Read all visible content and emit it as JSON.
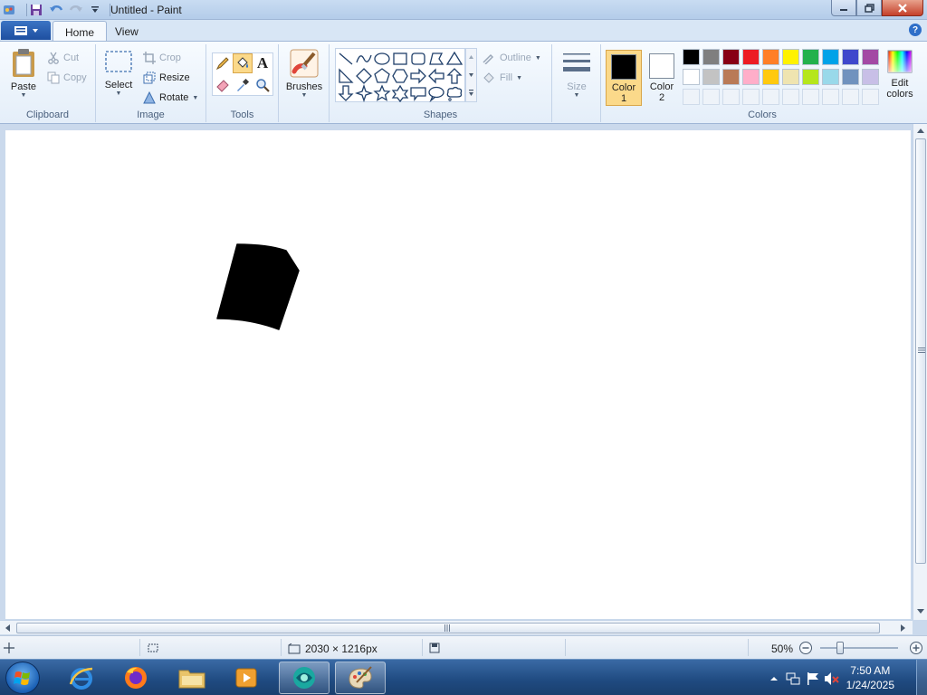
{
  "window": {
    "title": "Untitled - Paint"
  },
  "tabs": [
    {
      "label": "Home"
    },
    {
      "label": "View"
    }
  ],
  "clipboard": {
    "group_label": "Clipboard",
    "paste_label": "Paste",
    "cut_label": "Cut",
    "copy_label": "Copy"
  },
  "image": {
    "group_label": "Image",
    "select_label": "Select",
    "crop_label": "Crop",
    "resize_label": "Resize",
    "rotate_label": "Rotate"
  },
  "tools": {
    "group_label": "Tools",
    "text_tool_glyph": "A"
  },
  "brushes": {
    "label": "Brushes"
  },
  "shapes": {
    "group_label": "Shapes",
    "outline_label": "Outline",
    "fill_label": "Fill"
  },
  "size": {
    "label": "Size"
  },
  "colors": {
    "group_label": "Colors",
    "color1_label": "Color",
    "color1_num": "1",
    "color2_label": "Color",
    "color2_num": "2",
    "edit_label": "Edit",
    "edit_label2": "colors",
    "color1": "#000000",
    "color2": "#ffffff",
    "palette_row1": [
      "#000000",
      "#7f7f7f",
      "#880015",
      "#ed1c24",
      "#ff7f27",
      "#fff200",
      "#22b14c",
      "#00a2e8",
      "#3f48cc",
      "#a349a4"
    ],
    "palette_row2": [
      "#ffffff",
      "#c3c3c3",
      "#b97a57",
      "#ffaec9",
      "#ffc90e",
      "#efe4b0",
      "#b5e61d",
      "#99d9ea",
      "#7092be",
      "#c8bfe7"
    ]
  },
  "status": {
    "dimensions": "2030 × 1216px",
    "zoom": "50%"
  },
  "taskbar": {
    "time": "7:50 AM",
    "date": "1/24/2025"
  }
}
